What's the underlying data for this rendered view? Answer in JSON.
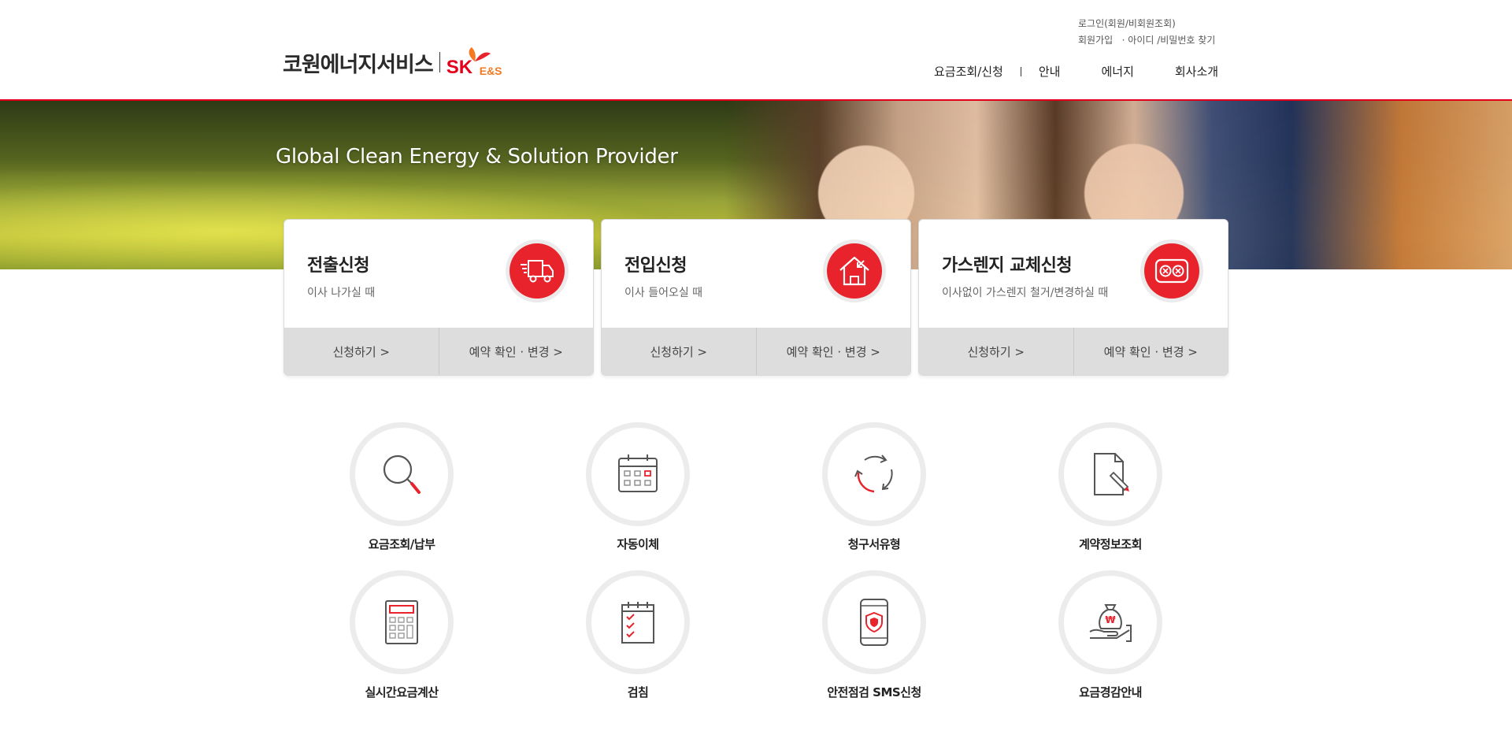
{
  "header": {
    "logo_text": "코원에너지서비스",
    "logo_sk": "SK",
    "logo_es": "E&S",
    "util": {
      "login": "로그인(회원/비회원조회)",
      "join": "회원가입",
      "dot": "·",
      "find": "아이디 /비밀번호 찾기"
    },
    "nav": [
      "요금조회/신청",
      "안내",
      "에너지",
      "회사소개"
    ]
  },
  "hero": {
    "slogan": "Global Clean Energy & Solution Provider"
  },
  "cards": [
    {
      "title": "전출신청",
      "desc": "이사 나가실 때",
      "icon": "moving-truck-icon",
      "apply": "신청하기 >",
      "check": "예약 확인 · 변경 >"
    },
    {
      "title": "전입신청",
      "desc": "이사 들어오실 때",
      "icon": "house-arrow-icon",
      "apply": "신청하기 >",
      "check": "예약 확인 · 변경 >"
    },
    {
      "title": "가스렌지 교체신청",
      "desc": "이사없이 가스렌지 철거/변경하실 때",
      "icon": "gas-range-icon",
      "apply": "신청하기 >",
      "check": "예약 확인 · 변경 >"
    }
  ],
  "quick_menu": [
    {
      "label": "요금조회/납부",
      "icon": "magnifier-icon"
    },
    {
      "label": "자동이체",
      "icon": "calendar-icon"
    },
    {
      "label": "청구서유형",
      "icon": "cycle-arrows-icon"
    },
    {
      "label": "계약정보조회",
      "icon": "document-pen-icon"
    },
    {
      "label": "실시간요금계산",
      "icon": "calculator-icon"
    },
    {
      "label": "검침",
      "icon": "checklist-icon"
    },
    {
      "label": "안전점검 SMS신청",
      "icon": "phone-shield-icon"
    },
    {
      "label": "요금경감안내",
      "icon": "money-bag-hand-icon"
    }
  ],
  "colors": {
    "accent": "#e9232c",
    "brand_orange": "#f47920",
    "card_button_bg": "#dddddd"
  }
}
